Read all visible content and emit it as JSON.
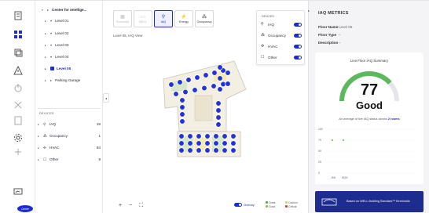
{
  "rail": {
    "icons": [
      "building-icon",
      "dashboard-icon",
      "layers-icon",
      "alert-icon",
      "power-icon",
      "tools-icon",
      "document-icon",
      "settings-icon",
      "plus-icon",
      "analytics-icon"
    ]
  },
  "tree": {
    "root": "Center for Intellige...",
    "levels": [
      "Level 01",
      "Level 02",
      "Level 03",
      "Level 04",
      "Level 05"
    ],
    "active_level": "Level 05",
    "garage": "Parking Garage"
  },
  "devices": {
    "heading": "DEVICES",
    "rows": [
      {
        "icon": "⚲",
        "label": "IAQ",
        "count": "19"
      },
      {
        "icon": "⁂",
        "label": "Occupancy",
        "count": "1"
      },
      {
        "icon": "✣",
        "label": "HVAC",
        "count": "84"
      },
      {
        "icon": "☐",
        "label": "Other",
        "count": "9"
      }
    ]
  },
  "map": {
    "tabs": [
      {
        "icon": "▦",
        "label": "Summary",
        "state": "dim"
      },
      {
        "icon": "▭",
        "label": "WELL",
        "state": "dim"
      },
      {
        "icon": "⚲",
        "label": "IAQ",
        "state": "on"
      },
      {
        "icon": "⚡",
        "label": "Energy",
        "state": "normal"
      },
      {
        "icon": "⁂",
        "label": "Occupancy",
        "state": "normal"
      }
    ],
    "view_label": "Level 05, IAQ View",
    "overlay": {
      "heading": "DEVICES",
      "rows": [
        {
          "icon": "⚲",
          "label": "IAQ"
        },
        {
          "icon": "⁂",
          "label": "Occupancy"
        },
        {
          "icon": "✣",
          "label": "HVAC"
        },
        {
          "icon": "☐",
          "label": "Other"
        }
      ]
    },
    "zoom": {
      "in": "+",
      "out": "−",
      "fit": "⛶"
    },
    "display_label": "Overlay",
    "legend": [
      {
        "label": "Great",
        "color": "#4caf50"
      },
      {
        "label": "Caution",
        "color": "#f2c94c"
      },
      {
        "label": "Good",
        "color": "#8bc34a"
      },
      {
        "label": "Critical",
        "color": "#e53935"
      }
    ]
  },
  "panel": {
    "title": "IAQ METRICS",
    "props": [
      {
        "key": "Floor Name",
        "value": "Level 05"
      },
      {
        "key": "Floor Type",
        "value": "–"
      },
      {
        "key": "Description",
        "value": "–"
      }
    ],
    "card_title": "Live Floor IAQ Summary",
    "score": "77",
    "score_label": "Good",
    "score_fraction": 0.77,
    "note_prefix": "An average of live IAQ status across",
    "note_link": "2 rooms",
    "chart_data": {
      "type": "scatter",
      "y_ticks": [
        "100",
        "75",
        "50",
        "25",
        "0"
      ],
      "x_ticks": [
        "JAN",
        "MON"
      ],
      "points": [
        {
          "x": "JAN",
          "y": 75
        },
        {
          "x": "MON",
          "y": 75
        }
      ],
      "ylim": [
        0,
        100
      ]
    },
    "well_text": "Based on WELL Building Standard™ thresholds",
    "logo": "Carrier"
  }
}
